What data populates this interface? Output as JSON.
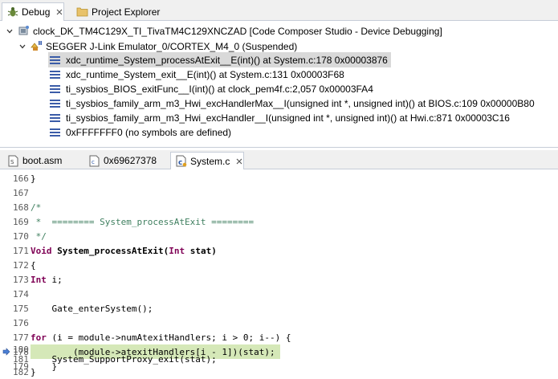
{
  "debug_view": {
    "tabs": [
      {
        "label": "Debug",
        "icon": "debug-bug-icon",
        "active": true
      },
      {
        "label": "Project Explorer",
        "icon": "folder-icon",
        "active": false
      }
    ],
    "tree": {
      "launch": "clock_DK_TM4C129X_TI_TivaTM4C129XNCZAD [Code Composer Studio - Device Debugging]",
      "target": "SEGGER J-Link Emulator_0/CORTEX_M4_0 (Suspended)",
      "frames": [
        "xdc_runtime_System_processAtExit__E(int)() at System.c:178 0x00003876",
        "xdc_runtime_System_exit__E(int)() at System.c:131 0x00003F68",
        "ti_sysbios_BIOS_exitFunc__I(int)() at clock_pem4f.c:2,057 0x00003FA4",
        "ti_sysbios_family_arm_m3_Hwi_excHandlerMax__I(unsigned int *, unsigned int)() at BIOS.c:109 0x00000B80",
        "ti_sysbios_family_arm_m3_Hwi_excHandler__I(unsigned int *, unsigned int)() at Hwi.c:871 0x00003C16",
        "0xFFFFFFF0  (no symbols are defined)"
      ]
    }
  },
  "editor": {
    "tabs": [
      {
        "label": "boot.asm",
        "icon": "asm-file-icon",
        "active": false
      },
      {
        "label": "0x69627378",
        "icon": "disassembly-icon",
        "active": false
      },
      {
        "label": "System.c",
        "icon": "c-file-icon",
        "active": true
      }
    ],
    "current_line": "178",
    "lines": [
      {
        "no": "166",
        "code": "}"
      },
      {
        "no": "167",
        "code": ""
      },
      {
        "no": "168",
        "code": "/*"
      },
      {
        "no": "169",
        "code": " *  ======== System_processAtExit ========"
      },
      {
        "no": "170",
        "code": " */"
      },
      {
        "no": "171",
        "code": "Void System_processAtExit(Int stat)"
      },
      {
        "no": "172",
        "code": "{"
      },
      {
        "no": "173",
        "code": "    Int i;"
      },
      {
        "no": "174",
        "code": ""
      },
      {
        "no": "175",
        "code": "    Gate_enterSystem();"
      },
      {
        "no": "176",
        "code": ""
      },
      {
        "no": "177",
        "code": "    for (i = module->numAtexitHandlers; i > 0; i--) {"
      },
      {
        "no": "178",
        "code": "        (module->atexitHandlers[i - 1])(stat);"
      },
      {
        "no": "179",
        "code": "    }"
      },
      {
        "no": "180",
        "code": ""
      },
      {
        "no": "181",
        "code": "    System_SupportProxy_exit(stat);"
      },
      {
        "no": "182",
        "code": "}"
      }
    ]
  },
  "colors": {
    "current_line_highlight": "#d5e8b8",
    "selected_frame": "#d9d9d9",
    "keyword": "#7f0055",
    "comment": "#3f7f5f",
    "tab_bar": "#f0f0f0"
  }
}
